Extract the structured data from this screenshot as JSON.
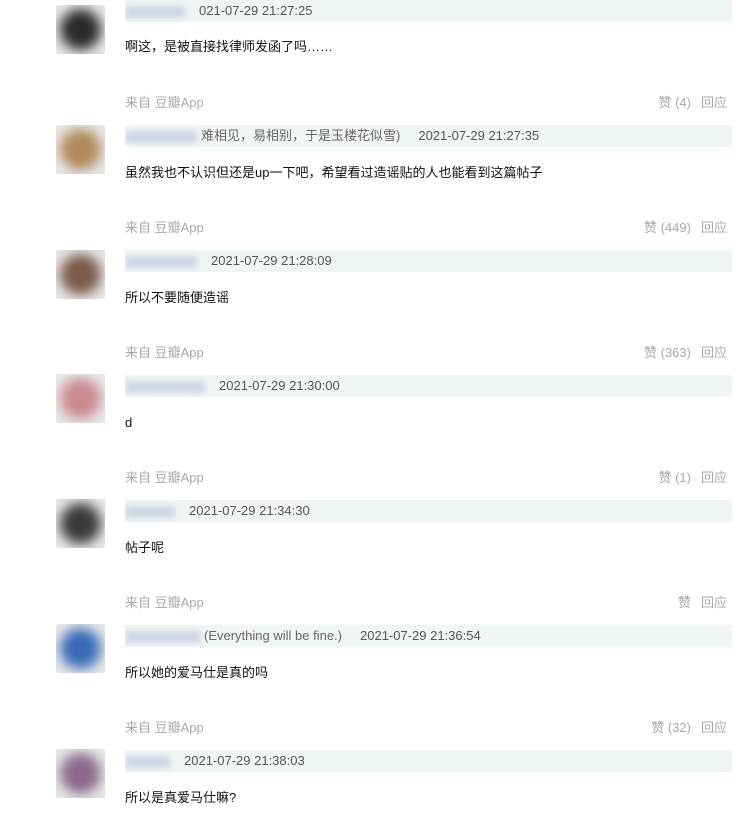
{
  "comments": [
    {
      "username_display": "",
      "signature": "",
      "time": "021-07-29 21:27:25",
      "text": "啊这，是被直接找律师发函了吗……",
      "source": "来自 豆瓣App",
      "likes": "赞 (4)",
      "reply": "回应",
      "avatar_color": "#2a2a2a"
    },
    {
      "username_display": "",
      "signature": "难相见，易相别，于是玉楼花似雪)",
      "time": "2021-07-29 21:27:35",
      "text": "虽然我也不认识但还是up一下吧，希望看过造谣贴的人也能看到这篇帖子",
      "source": "来自 豆瓣App",
      "likes": "赞 (449)",
      "reply": "回应",
      "avatar_color": "#b08a5a"
    },
    {
      "username_display": "",
      "signature": "",
      "time": "2021-07-29 21:28:09",
      "text": "所以不要随便造谣",
      "source": "来自 豆瓣App",
      "likes": "赞 (363)",
      "reply": "回应",
      "avatar_color": "#7a5a48"
    },
    {
      "username_display": "",
      "signature": "",
      "time": "2021-07-29 21:30:00",
      "text": "d",
      "source": "来自 豆瓣App",
      "likes": "赞 (1)",
      "reply": "回应",
      "avatar_color": "#c98a90"
    },
    {
      "username_display": "",
      "signature": "",
      "time": "2021-07-29 21:34:30",
      "text": "帖子呢",
      "source": "来自 豆瓣App",
      "likes": "赞",
      "reply": "回应",
      "avatar_color": "#3a3a3a"
    },
    {
      "username_display": "",
      "signature": "(Everything will be fine.)",
      "time": "2021-07-29 21:36:54",
      "text": "所以她的爱马仕是真的吗",
      "source": "来自 豆瓣App",
      "likes": "赞 (32)",
      "reply": "回应",
      "avatar_color": "#3a6ab8"
    },
    {
      "username_display": "",
      "signature": "",
      "time": "2021-07-29 21:38:03",
      "text": "所以是真爱马仕嘛?",
      "source": "",
      "likes": "",
      "reply": "",
      "avatar_color": "#8a6a8a"
    }
  ]
}
